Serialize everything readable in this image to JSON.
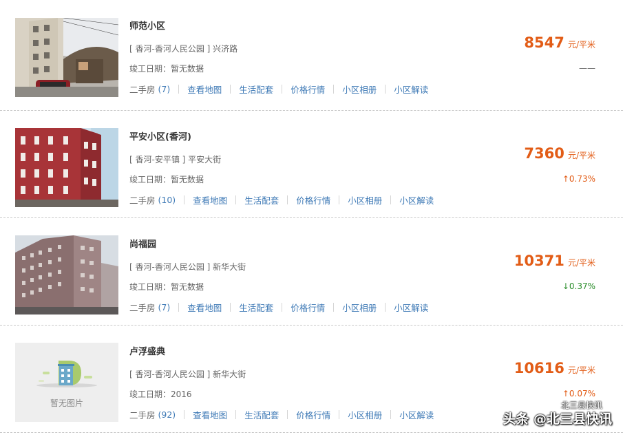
{
  "listings": [
    {
      "name": "师范小区",
      "address": "[ 香河-香河人民公园 ] 兴济路",
      "completion": "竣工日期：暂无数据",
      "esf_label": "二手房",
      "esf_count": "(7)",
      "price": "8547",
      "unit": "元/平米",
      "change": "——",
      "change_dir": "none",
      "image": "photo"
    },
    {
      "name": "平安小区(香河)",
      "address": "[ 香河-安平镇 ] 平安大街",
      "completion": "竣工日期：暂无数据",
      "esf_label": "二手房",
      "esf_count": "(10)",
      "price": "7360",
      "unit": "元/平米",
      "change": "↑0.73%",
      "change_dir": "up",
      "image": "photo"
    },
    {
      "name": "尚福园",
      "address": "[ 香河-香河人民公园 ] 新华大街",
      "completion": "竣工日期：暂无数据",
      "esf_label": "二手房",
      "esf_count": "(7)",
      "price": "10371",
      "unit": "元/平米",
      "change": "↓0.37%",
      "change_dir": "down",
      "image": "photo"
    },
    {
      "name": "卢浮盛典",
      "address": "[ 香河-香河人民公园 ] 新华大街",
      "completion": "竣工日期：2016",
      "esf_label": "二手房",
      "esf_count": "(92)",
      "price": "10616",
      "unit": "元/平米",
      "change": "↑0.07%",
      "change_dir": "up",
      "image": "placeholder",
      "image_placeholder_text": "暂无图片"
    }
  ],
  "links": {
    "map": "查看地图",
    "life": "生活配套",
    "price": "价格行情",
    "album": "小区相册",
    "interpret": "小区解读"
  },
  "watermark": {
    "source": "头条 @北三县快讯",
    "top_text": "北三县快讯"
  },
  "colors": {
    "price": "#e25c16",
    "link": "#3f7ab6",
    "down": "#2a8d2a"
  }
}
